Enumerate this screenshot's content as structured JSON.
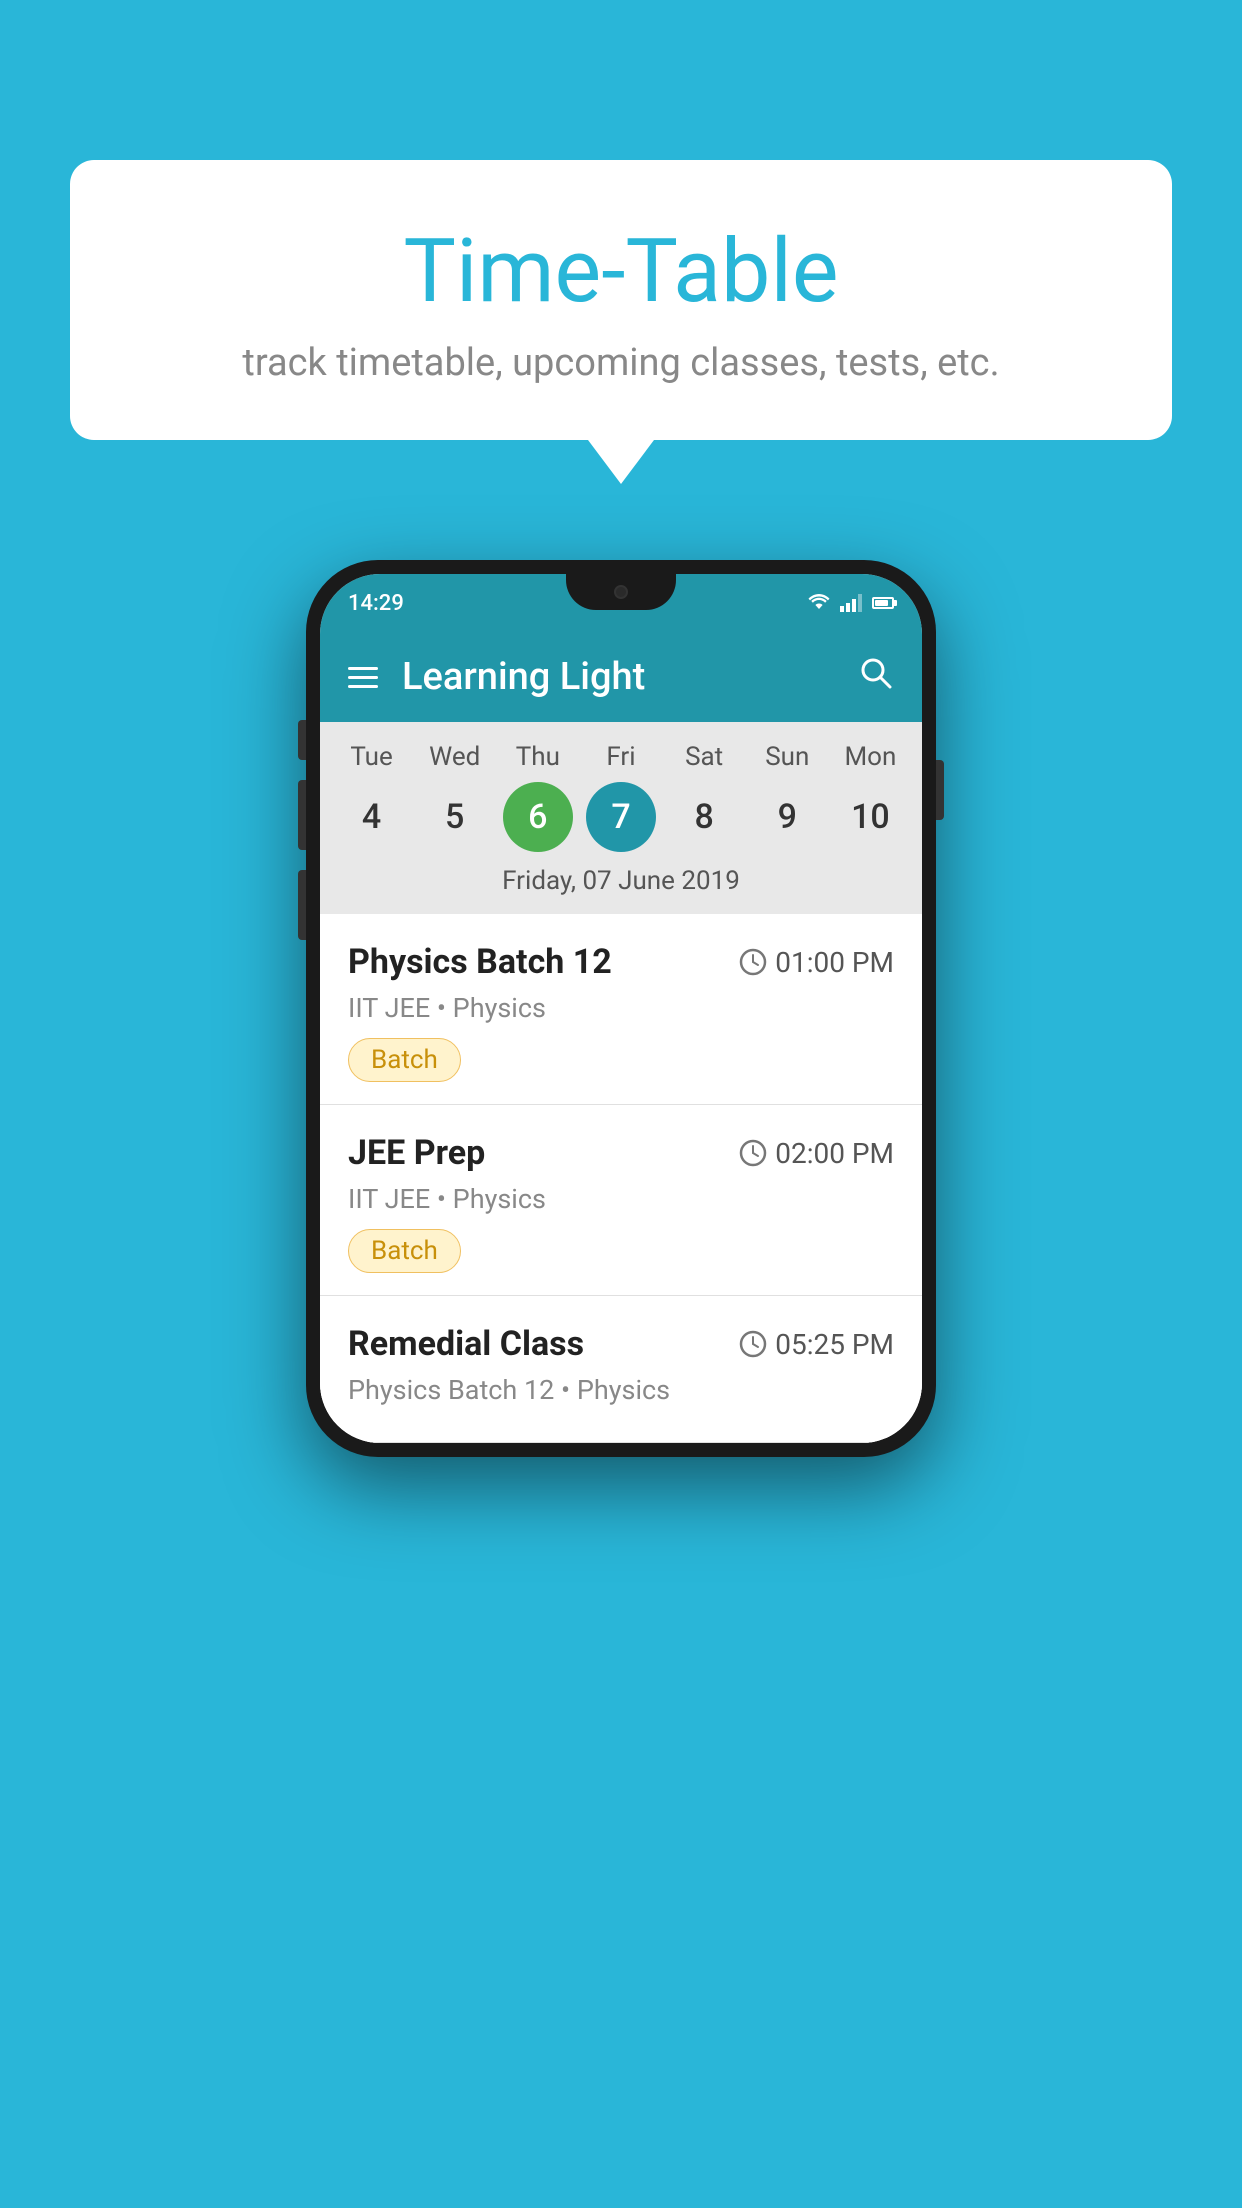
{
  "background_color": "#29b6d8",
  "speech_bubble": {
    "title": "Time-Table",
    "subtitle": "track timetable, upcoming classes, tests, etc."
  },
  "phone": {
    "status_bar": {
      "time": "14:29"
    },
    "app_header": {
      "title": "Learning Light"
    },
    "calendar": {
      "days": [
        {
          "label": "Tue",
          "number": "4"
        },
        {
          "label": "Wed",
          "number": "5"
        },
        {
          "label": "Thu",
          "number": "6",
          "state": "today"
        },
        {
          "label": "Fri",
          "number": "7",
          "state": "selected"
        },
        {
          "label": "Sat",
          "number": "8"
        },
        {
          "label": "Sun",
          "number": "9"
        },
        {
          "label": "Mon",
          "number": "10"
        }
      ],
      "selected_date_label": "Friday, 07 June 2019"
    },
    "classes": [
      {
        "name": "Physics Batch 12",
        "time": "01:00 PM",
        "subtitle": "IIT JEE • Physics",
        "badge": "Batch"
      },
      {
        "name": "JEE Prep",
        "time": "02:00 PM",
        "subtitle": "IIT JEE • Physics",
        "badge": "Batch"
      },
      {
        "name": "Remedial Class",
        "time": "05:25 PM",
        "subtitle": "Physics Batch 12 • Physics",
        "badge": null
      }
    ]
  }
}
